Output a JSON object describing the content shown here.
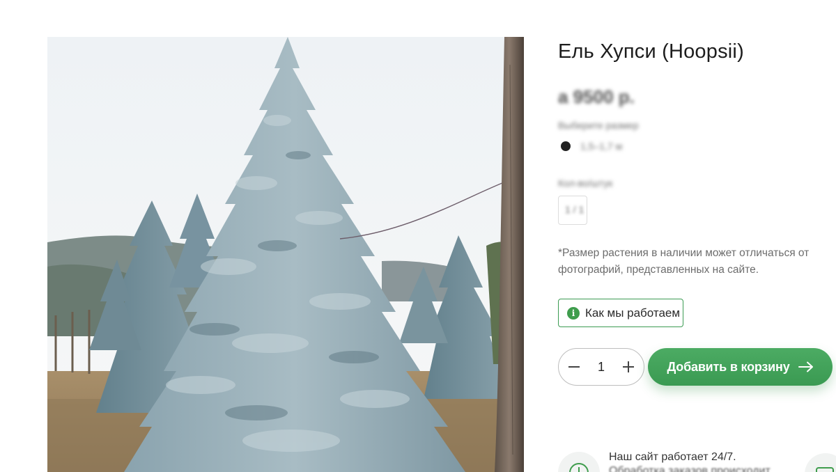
{
  "product": {
    "title": "Ель Хупси (Hoopsii)",
    "price": "а 9500 р.",
    "size_label": "Выберите размер",
    "size_option": "1,5–1,7 м",
    "pack_label": "Кол-во/штук",
    "pack_value": "1 / 1",
    "note": "*Размер растения в наличии может отличаться от фотографий, представленных на сайте."
  },
  "actions": {
    "how_we_work": "Как мы работаем",
    "info_symbol": "i",
    "quantity": "1",
    "add_to_cart": "Добавить в корзину"
  },
  "service": {
    "line1": "Наш сайт работает 24/7.",
    "line2": "Обработка заказов происходит"
  },
  "colors": {
    "accent_green": "#3f9d4d",
    "button_green": "#43a45a",
    "text_muted": "#6c6c6c"
  },
  "icons": {
    "info": "info-icon",
    "minus": "minus-icon",
    "plus": "plus-icon",
    "arrow": "arrow-right-icon",
    "clock": "clock-icon",
    "camera": "camera-icon"
  }
}
